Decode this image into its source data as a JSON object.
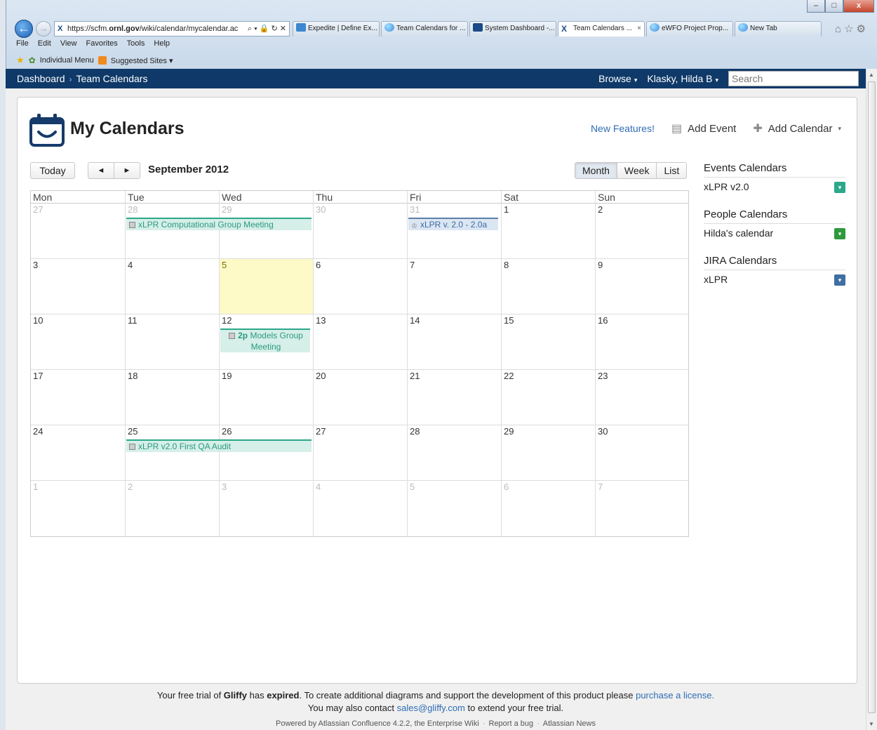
{
  "browser": {
    "url_prefix": "https://scfm.",
    "url_domain": "ornl.gov",
    "url_rest": "/wiki/calendar/mycalendar.ac",
    "addr_tools": "⌕ ▾ 🔒 ↻ ✕",
    "tabs": [
      {
        "label": "Expedite | Define Ex...",
        "close": ""
      },
      {
        "label": "Team Calendars for ...",
        "close": ""
      },
      {
        "label": "System Dashboard -...",
        "close": ""
      },
      {
        "label": "Team Calendars ...",
        "close": "×"
      },
      {
        "label": "eWFO Project Prop...",
        "close": ""
      },
      {
        "label": "New Tab",
        "close": ""
      }
    ],
    "menu": [
      "File",
      "Edit",
      "View",
      "Favorites",
      "Tools",
      "Help"
    ],
    "favorites": {
      "individual_menu": "Individual Menu",
      "suggested_sites": "Suggested Sites ▾"
    },
    "right_icons": "⌂☆⚙",
    "window_buttons": {
      "minimize": "–",
      "maximize": "□",
      "close": "x"
    }
  },
  "header": {
    "crumbs": [
      "Dashboard",
      "Team Calendars"
    ],
    "crumb_sep": "›",
    "browse": "Browse",
    "user": "Klasky, Hilda B",
    "caret": "▾",
    "search_placeholder": "Search"
  },
  "page": {
    "title": "My Calendars",
    "new_features": "New Features!",
    "add_event": "Add Event",
    "add_calendar": "Add Calendar",
    "add_calendar_caret": "▾",
    "today": "Today",
    "prev": "◄",
    "next": "►",
    "month": "September 2012",
    "views": [
      "Month",
      "Week",
      "List"
    ],
    "active_view": "Month"
  },
  "calendar": {
    "days_of_week": [
      "Mon",
      "Tue",
      "Wed",
      "Thu",
      "Fri",
      "Sat",
      "Sun"
    ],
    "weeks": [
      [
        {
          "d": "27",
          "o": true
        },
        {
          "d": "28",
          "o": true
        },
        {
          "d": "29",
          "o": true
        },
        {
          "d": "30",
          "o": true
        },
        {
          "d": "31",
          "o": true
        },
        {
          "d": "1"
        },
        {
          "d": "2"
        }
      ],
      [
        {
          "d": "3"
        },
        {
          "d": "4"
        },
        {
          "d": "5",
          "today": true
        },
        {
          "d": "6"
        },
        {
          "d": "7"
        },
        {
          "d": "8"
        },
        {
          "d": "9"
        }
      ],
      [
        {
          "d": "10"
        },
        {
          "d": "11"
        },
        {
          "d": "12"
        },
        {
          "d": "13"
        },
        {
          "d": "14"
        },
        {
          "d": "15"
        },
        {
          "d": "16"
        }
      ],
      [
        {
          "d": "17"
        },
        {
          "d": "18"
        },
        {
          "d": "19"
        },
        {
          "d": "20"
        },
        {
          "d": "21"
        },
        {
          "d": "22"
        },
        {
          "d": "23"
        }
      ],
      [
        {
          "d": "24"
        },
        {
          "d": "25"
        },
        {
          "d": "26"
        },
        {
          "d": "27"
        },
        {
          "d": "28"
        },
        {
          "d": "29"
        },
        {
          "d": "30"
        }
      ],
      [
        {
          "d": "1",
          "o": true
        },
        {
          "d": "2",
          "o": true
        },
        {
          "d": "3",
          "o": true
        },
        {
          "d": "4",
          "o": true
        },
        {
          "d": "5",
          "o": true
        },
        {
          "d": "6",
          "o": true
        },
        {
          "d": "7",
          "o": true
        }
      ]
    ],
    "events": {
      "comp_group": "xLPR Computational Group Meeting",
      "xlpr_version": "xLPR v. 2.0 - 2.0a",
      "models_time": "2p",
      "models_title": "Models Group Meeting",
      "qa_audit": "xLPR v2.0 First QA Audit"
    }
  },
  "sidebar": {
    "sections": [
      {
        "title": "Events Calendars",
        "items": [
          {
            "label": "xLPR v2.0",
            "color": "#2ba88a"
          }
        ]
      },
      {
        "title": "People Calendars",
        "items": [
          {
            "label": "Hilda's calendar",
            "color": "#2e9a3b"
          }
        ]
      },
      {
        "title": "JIRA Calendars",
        "items": [
          {
            "label": "xLPR",
            "color": "#3f6fa3"
          }
        ]
      }
    ],
    "swatch_caret": "▾"
  },
  "footer": {
    "line1_a": "Your free trial of ",
    "line1_gliffy": "Gliffy",
    "line1_b": " has ",
    "line1_expired": "expired",
    "line1_c": ". To create additional diagrams and support the development of this product please ",
    "line1_link": "purchase a license.",
    "line2_a": "You may also contact ",
    "line2_link": "sales@gliffy.com",
    "line2_b": " to extend your free trial.",
    "powered": "Powered by Atlassian Confluence 4.2.2, the Enterprise Wiki",
    "report_bug": "Report a bug",
    "news": "Atlassian News",
    "sep": "·"
  }
}
